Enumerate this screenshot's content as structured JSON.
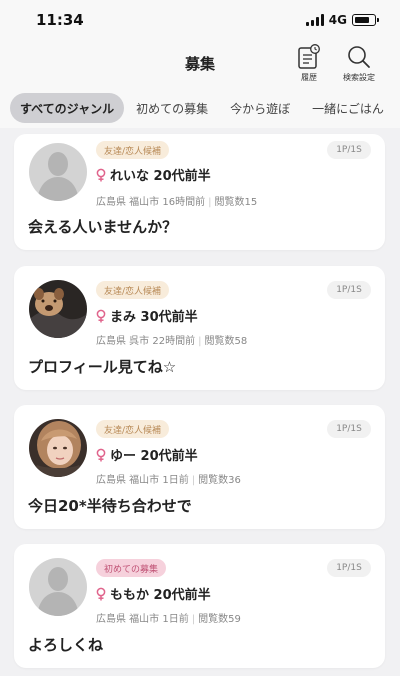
{
  "status": {
    "time": "11:34",
    "network": "4G"
  },
  "header": {
    "title": "募集",
    "history_label": "履歴",
    "search_label": "検索設定"
  },
  "tabs": [
    {
      "label": "すべてのジャンル",
      "active": true
    },
    {
      "label": "初めての募集",
      "active": false
    },
    {
      "label": "今から遊ぼ",
      "active": false
    },
    {
      "label": "一緒にごはん",
      "active": false
    }
  ],
  "posts": [
    {
      "tag": "友達/恋人候補",
      "page": "1P/1S",
      "name": "れいな 20代前半",
      "location": "広島県 福山市 16時間前",
      "views": "閲覧数15",
      "message": "会える人いませんか？",
      "avatar": "silhouette-avatar"
    },
    {
      "tag": "友達/恋人候補",
      "page": "1P/1S",
      "name": "まみ 30代前半",
      "location": "広島県 呉市 22時間前",
      "views": "閲覧数58",
      "message": "プロフィール見てね☆",
      "avatar": "dog-filter-photo-avatar"
    },
    {
      "tag": "友達/恋人候補",
      "page": "1P/1S",
      "name": "ゆー 20代前半",
      "location": "広島県 福山市 1日前",
      "views": "閲覧数36",
      "message": "今日20*半待ち合わせで",
      "avatar": "photo-avatar"
    },
    {
      "tag": "初めての募集",
      "page": "1P/1S",
      "name": "ももか 20代前半",
      "location": "広島県 福山市 1日前",
      "views": "閲覧数59",
      "message": "よろしくね",
      "avatar": "silhouette-avatar"
    }
  ],
  "colors": {
    "background": "#f1f1f3",
    "female_icon": "#e0648c",
    "tag_friend_bg": "#f8ecdb",
    "tag_first_bg": "#f6d1dc"
  }
}
